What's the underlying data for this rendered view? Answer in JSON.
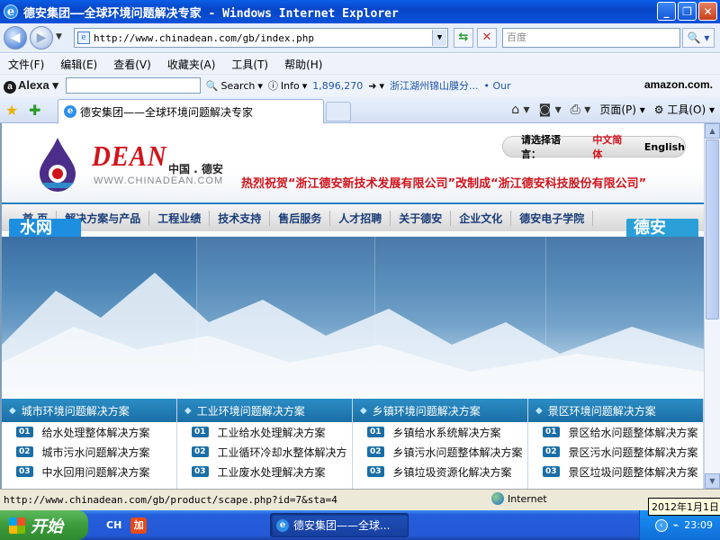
{
  "window": {
    "title": "德安集团——全球环境问题解决专家 - Windows Internet Explorer",
    "min_label": "_",
    "max_label": "❐",
    "close_label": "✕"
  },
  "address": {
    "url": "http://www.chinadean.com/gb/index.php",
    "search_placeholder": "百度"
  },
  "menu": [
    "文件(F)",
    "编辑(E)",
    "查看(V)",
    "收藏夹(A)",
    "工具(T)",
    "帮助(H)"
  ],
  "alexa": {
    "logo": "Alexa",
    "search_label": "Search",
    "info_label": "Info",
    "rank": "1,896,270",
    "ticker": "浙江湖州锦山膜分...",
    "ticker_suffix": "• Our",
    "amazon": "amazon.com."
  },
  "tab": {
    "title": "德安集团——全球环境问题解决专家"
  },
  "cmdbar": {
    "page_label": "页面(P)",
    "tools_label": "工具(O)"
  },
  "site": {
    "brand": "DEAN",
    "brand_cn": "中国 . 德安",
    "brand_url": "WWW.CHINADEAN.COM",
    "lang_prompt": "请选择语言：",
    "lang_cn": "中文简体",
    "lang_en": "English",
    "congrats": "热烈祝贺“浙江德安新技术发展有限公司”改制成“浙江德安科技股份有限公司”",
    "nav": [
      "首  页",
      "解决方案与产品",
      "工程业绩",
      "技术支持",
      "售后服务",
      "人才招聘",
      "关于德安",
      "企业文化",
      "德安电子学院"
    ],
    "badge_left": "水网",
    "badge_right": "德安"
  },
  "solutions": [
    {
      "title": "城市环境问题解决方案",
      "items": [
        {
          "num": "01",
          "label": "给水处理整体解决方案"
        },
        {
          "num": "02",
          "label": "城市污水问题解决方案"
        },
        {
          "num": "03",
          "label": "中水回用问题解决方案"
        }
      ]
    },
    {
      "title": "工业环境问题解决方案",
      "items": [
        {
          "num": "01",
          "label": "工业给水处理解决方案"
        },
        {
          "num": "02",
          "label": "工业循环冷却水整体解决方"
        },
        {
          "num": "03",
          "label": "工业废水处理解决方案"
        }
      ]
    },
    {
      "title": "乡镇环境问题解决方案",
      "items": [
        {
          "num": "01",
          "label": "乡镇给水系统解决方案"
        },
        {
          "num": "02",
          "label": "乡镇污水问题整体解决方案"
        },
        {
          "num": "03",
          "label": "乡镇垃圾资源化解决方案"
        }
      ]
    },
    {
      "title": "景区环境问题解决方案",
      "items": [
        {
          "num": "01",
          "label": "景区给水问题整体解决方案"
        },
        {
          "num": "02",
          "label": "景区污水问题整体解决方案"
        },
        {
          "num": "03",
          "label": "景区垃圾问题整体解决方案"
        }
      ]
    }
  ],
  "status": {
    "url": "http://www.chinadean.com/gb/product/scape.php?id=7&sta=4",
    "zone": "Internet"
  },
  "taskbar": {
    "start": "开始",
    "lang": "CH",
    "app_badge": "加",
    "ie_task": "德安集团——全球...",
    "clock": "23:09",
    "tooltip": "2012年1月1日"
  },
  "colors": {
    "brand_red": "#d0141c",
    "nav_blue": "#1a3c78",
    "solution_header": "#1a6ea5"
  }
}
